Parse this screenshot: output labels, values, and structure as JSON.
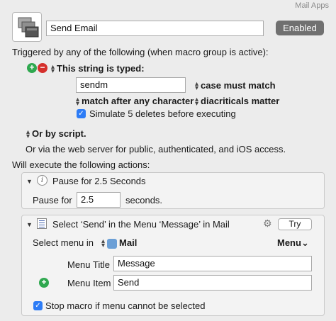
{
  "group_name": "Mail Apps",
  "macro": {
    "name": "Send Email",
    "enabled_label": "Enabled"
  },
  "triggers": {
    "heading": "Triggered by any of the following (when macro group is active):",
    "add_symbol": "+",
    "remove_symbol": "−",
    "string_trigger_label": "This string is typed:",
    "string_value": "sendm",
    "case_option": "case must match",
    "match_option": "match after any character",
    "diacriticals_option": "diacriticals matter",
    "simulate_deletes_label": "Simulate 5 deletes before executing",
    "simulate_deletes_checked": true,
    "script_trigger_label": "Or by script.",
    "web_server_text": "Or via the web server for public, authenticated, and iOS access."
  },
  "actions": {
    "heading": "Will execute the following actions:",
    "pause": {
      "title": "Pause for 2.5 Seconds",
      "label_before": "Pause for",
      "value": "2.5",
      "label_after": "seconds."
    },
    "select_menu": {
      "title": "Select ‘Send’ in the Menu ‘Message’ in Mail",
      "try_label": "Try",
      "select_menu_in_label": "Select menu in",
      "app_name": "Mail",
      "menu_dropdown_label": "Menu",
      "menu_title_label": "Menu Title",
      "menu_title_value": "Message",
      "menu_item_label": "Menu Item",
      "menu_item_value": "Send",
      "stop_macro_label": "Stop macro if menu cannot be selected",
      "stop_macro_checked": true
    }
  },
  "colors": {
    "accent": "#2d7cf6",
    "add": "#2fa84f",
    "remove": "#d5302c",
    "enabled_button": "#707070"
  }
}
